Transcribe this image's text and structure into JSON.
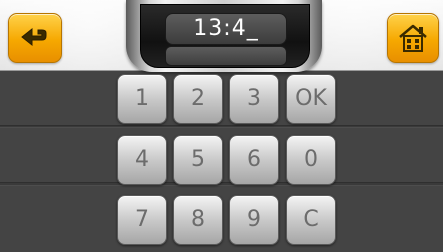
{
  "header": {
    "time_value": "13:4_",
    "secondary_value": ""
  },
  "buttons": {
    "back_icon": "back-arrow-icon",
    "home_icon": "home-icon"
  },
  "keypad": {
    "rows": [
      [
        "1",
        "2",
        "3",
        "OK"
      ],
      [
        "4",
        "5",
        "6",
        "0"
      ],
      [
        "7",
        "8",
        "9",
        "C"
      ]
    ]
  },
  "colors": {
    "accent_button": "#f6a800",
    "background": "#3a3a3a",
    "key_face": "#cfcfcf",
    "key_text": "#6c6c6c"
  }
}
